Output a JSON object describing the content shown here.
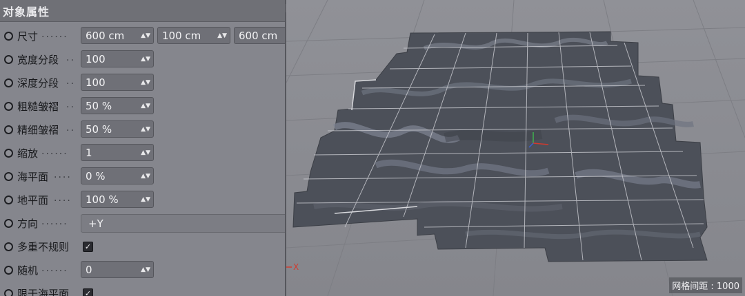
{
  "panel": {
    "title": "对象属性",
    "size": {
      "label": "尺寸",
      "dots": "......",
      "x": "600 cm",
      "y": "100 cm",
      "z": "600 cm"
    },
    "width_segments": {
      "label": "宽度分段",
      "dots": "..",
      "value": "100"
    },
    "depth_segments": {
      "label": "深度分段",
      "dots": "..",
      "value": "100"
    },
    "rough_wrinkle": {
      "label": "粗糙皱褶",
      "dots": "..",
      "value": "50 %"
    },
    "fine_wrinkle": {
      "label": "精细皱褶",
      "dots": "..",
      "value": "50 %"
    },
    "scale": {
      "label": "缩放",
      "dots": "......",
      "value": "1"
    },
    "sea_level": {
      "label": "海平面",
      "dots": "....",
      "value": "0 %"
    },
    "ground_level": {
      "label": "地平面",
      "dots": "....",
      "value": "100 %"
    },
    "orientation": {
      "label": "方向",
      "dots": "......",
      "value": "+Y"
    },
    "multi_irregular": {
      "label": "多重不规则",
      "checked": true
    },
    "random": {
      "label": "随机",
      "dots": "......",
      "value": "0"
    },
    "limit_sea_level": {
      "label": "限于海平面",
      "checked": true
    },
    "spinner_glyph": "▲▼",
    "check_glyph": "✓"
  },
  "viewport": {
    "grid_spacing": "网格间距 : 1000",
    "axis_label": "X",
    "colors": {
      "background": "#8b8c92",
      "terrain": "#4c5059",
      "terrain_light": "#6b7080",
      "grid": "#c9cad0"
    }
  }
}
